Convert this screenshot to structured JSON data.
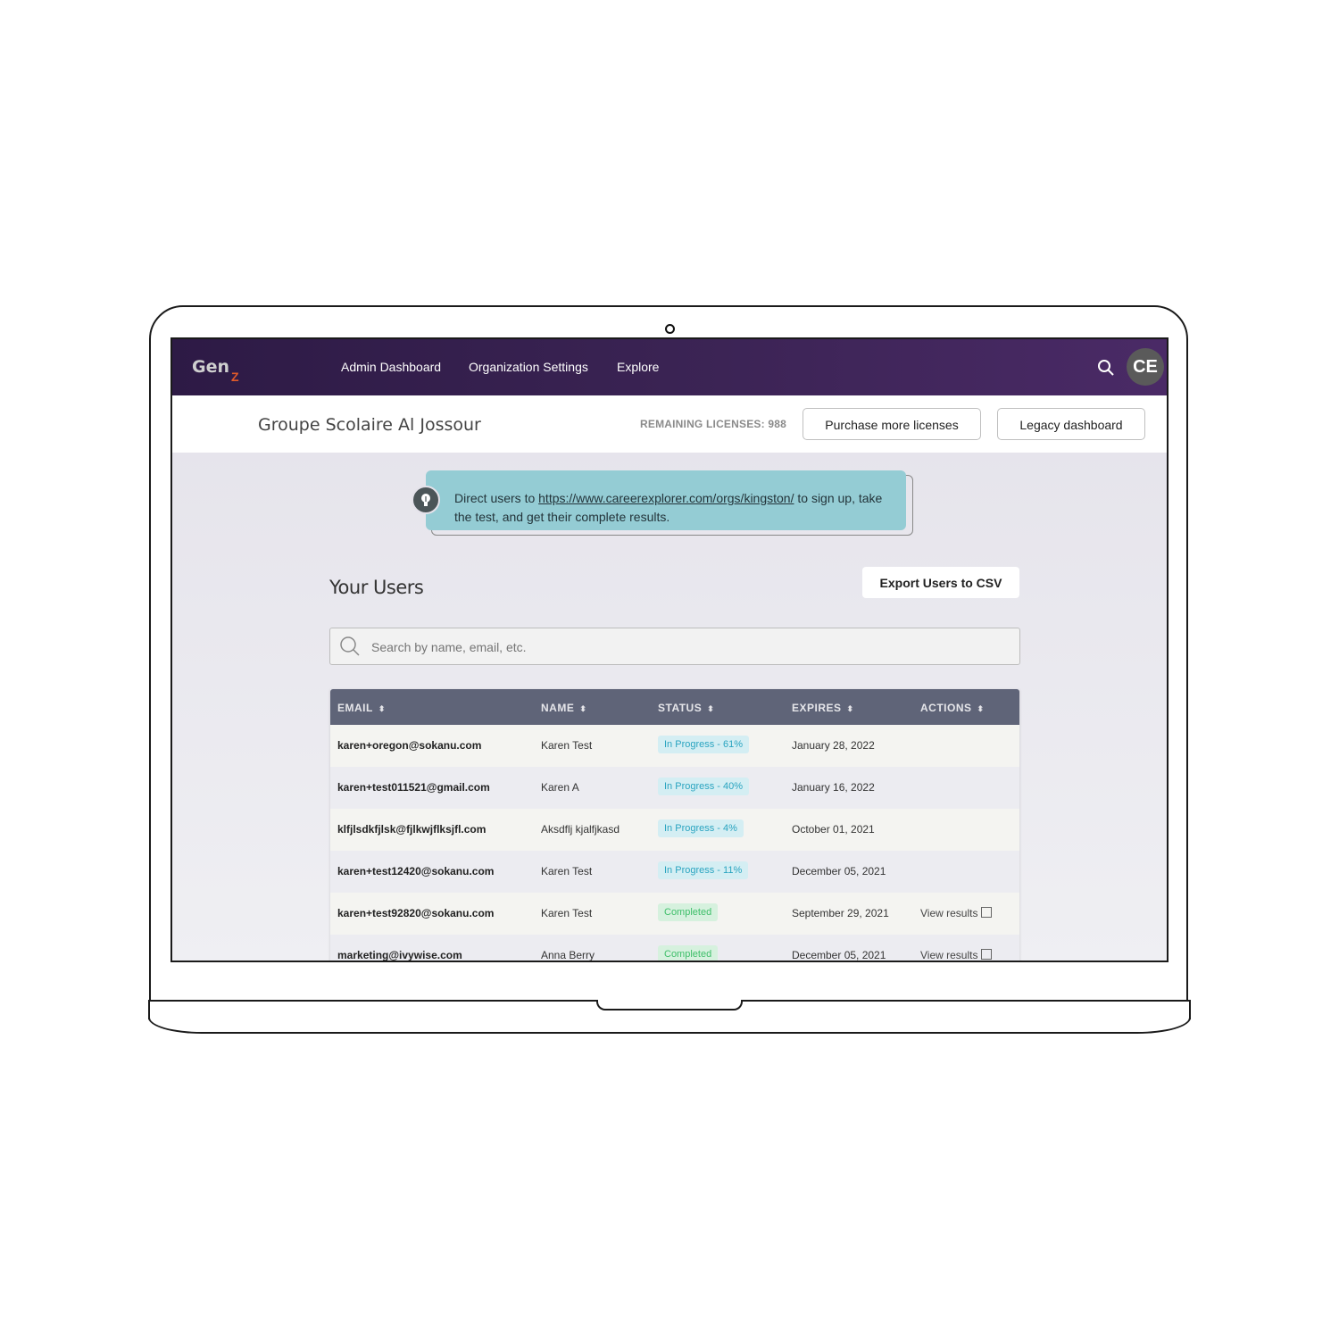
{
  "nav": {
    "logo": "Gen",
    "logo_z": "Z",
    "links": [
      "Admin Dashboard",
      "Organization Settings",
      "Explore"
    ],
    "avatar": "CE"
  },
  "org": {
    "name": "Groupe Scolaire Al Jossour",
    "licenses": "REMAINING LICENSES: 988",
    "purchase_label": "Purchase more licenses",
    "legacy_label": "Legacy dashboard"
  },
  "tip": {
    "prefix": "Direct users to ",
    "link": "https://www.careerexplorer.com/orgs/kingston/",
    "suffix": " to sign up, take the test, and get their complete results."
  },
  "users": {
    "title": "Your Users",
    "export_label": "Export Users to CSV",
    "search_placeholder": "Search by name, email, etc."
  },
  "table": {
    "headers": [
      "EMAIL",
      "NAME",
      "STATUS",
      "EXPIRES",
      "ACTIONS"
    ],
    "sort_glyph": "⬍",
    "rows": [
      {
        "email": "karen+oregon@sokanu.com",
        "name": "Karen Test",
        "status": "In Progress - 61%",
        "status_type": "progress",
        "expires": "January 28, 2022",
        "action": ""
      },
      {
        "email": "karen+test011521@gmail.com",
        "name": "Karen A",
        "status": "In Progress - 40%",
        "status_type": "progress",
        "expires": "January 16, 2022",
        "action": ""
      },
      {
        "email": "klfjlsdkfjlsk@fjlkwjflksjfl.com",
        "name": "Aksdflj kjalfjkasd",
        "status": "In Progress - 4%",
        "status_type": "progress",
        "expires": "October 01, 2021",
        "action": ""
      },
      {
        "email": "karen+test12420@sokanu.com",
        "name": "Karen Test",
        "status": "In Progress - 11%",
        "status_type": "progress",
        "expires": "December 05, 2021",
        "action": ""
      },
      {
        "email": "karen+test92820@sokanu.com",
        "name": "Karen Test",
        "status": "Completed",
        "status_type": "completed",
        "expires": "September 29, 2021",
        "action": "View results"
      },
      {
        "email": "marketing@ivywise.com",
        "name": "Anna Berry",
        "status": "Completed",
        "status_type": "completed",
        "expires": "December 05, 2021",
        "action": "View results"
      }
    ]
  },
  "colors": {
    "nav_start": "#2d1a45",
    "nav_end": "#4a2a66",
    "tip_bg": "#94ccd4",
    "progress": "#2aa4c0",
    "completed": "#3fbf6a",
    "table_header": "#5f6478"
  },
  "icons": [
    "search-icon",
    "lightbulb-icon",
    "external-link-icon",
    "sort-icon"
  ]
}
